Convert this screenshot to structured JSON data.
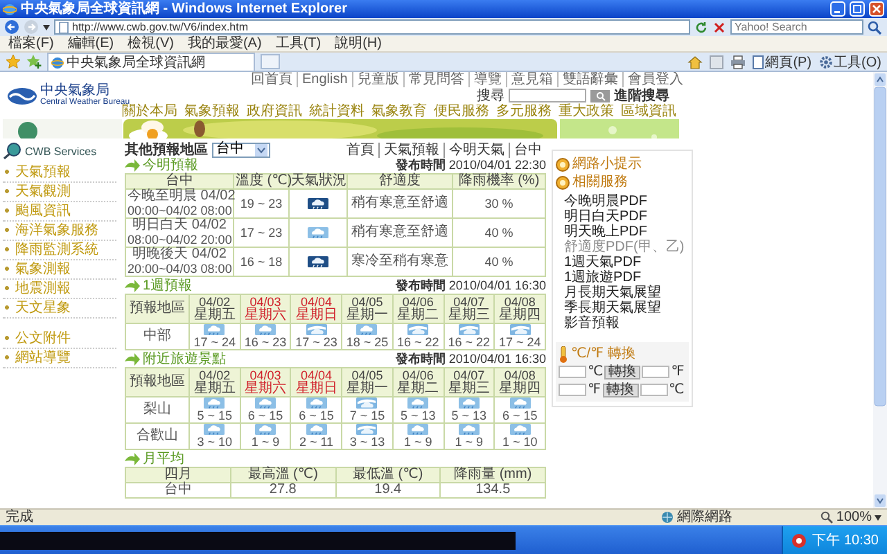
{
  "window": {
    "title": "中央氣象局全球資訊網 - Windows Internet Explorer"
  },
  "address_bar": {
    "url": "http://www.cwb.gov.tw/V6/index.htm"
  },
  "search_box": {
    "placeholder": "Yahoo! Search"
  },
  "menu": [
    "檔案(F)",
    "編輯(E)",
    "檢視(V)",
    "我的最愛(A)",
    "工具(T)",
    "說明(H)"
  ],
  "tab": {
    "title": "中央氣象局全球資訊網"
  },
  "toolbar": [
    {
      "kind": "page",
      "label": "網頁(P)"
    },
    {
      "kind": "tools",
      "label": "工具(O)"
    }
  ],
  "site": {
    "logo_name": "中央氣象局",
    "logo_english": "Central Weather Bureau",
    "top_links": [
      "回首頁",
      "English",
      "兒童版",
      "常見問答",
      "導覽",
      "意見箱",
      "雙語辭彙",
      "會員登入"
    ],
    "search_label": "搜尋",
    "advanced_search": "進階搜尋",
    "nav": [
      "關於本局",
      "氣象預報",
      "政府資訊",
      "統計資料",
      "氣象教育",
      "便民服務",
      "多元服務",
      "重大政策",
      "區域資訊"
    ]
  },
  "sidebar": {
    "title": "CWB Services",
    "items": [
      "天氣預報",
      "天氣觀測",
      "颱風資訊",
      "海洋氣象服務",
      "降雨監測系統",
      "氣象測報",
      "地震測報",
      "天文星象"
    ],
    "extra_items": [
      "公文附件",
      "網站導覽"
    ]
  },
  "breadcrumb": [
    "首頁",
    "天氣預報",
    "今明天氣",
    "台中"
  ],
  "region_select": {
    "label": "其他預報地區",
    "value": "台中"
  },
  "today": {
    "title": "今明預報",
    "issued": "**發布時間** 2010/04/01 22:30",
    "columns": [
      "台中",
      "溫度 (℃)",
      "天氣狀況",
      "舒適度",
      "降雨機率 (%)"
    ],
    "rows": [
      {
        "period": "今晚至明晨 04/02",
        "range": "00:00~04/02 08:00",
        "temperature": "19 ~ 23",
        "kind": "rain",
        "comfort": "稍有寒意至舒適",
        "rain_chance": "30 %"
      },
      {
        "period": "明日白天 04/02",
        "range": "08:00~04/02 20:00",
        "temperature": "17 ~ 23",
        "kind": "showers",
        "comfort": "稍有寒意至舒適",
        "rain_chance": "40 %"
      },
      {
        "period": "明晚後天 04/02",
        "range": "20:00~04/03 08:00",
        "temperature": "16 ~ 18",
        "kind": "rain",
        "comfort": "寒冷至稍有寒意",
        "rain_chance": "40 %"
      }
    ]
  },
  "week": {
    "title": "1週預報",
    "issued": "**發布時間** 2010/04/01 16:30",
    "corner": "預報地區",
    "days": [
      {
        "date": "04/02",
        "weekday": "星期五",
        "holiday": false
      },
      {
        "date": "04/03",
        "weekday": "星期六",
        "holiday": true
      },
      {
        "date": "04/04",
        "weekday": "星期日",
        "holiday": true
      },
      {
        "date": "04/05",
        "weekday": "星期一",
        "holiday": false
      },
      {
        "date": "04/06",
        "weekday": "星期二",
        "holiday": false
      },
      {
        "date": "04/07",
        "weekday": "星期三",
        "holiday": false
      },
      {
        "date": "04/08",
        "weekday": "星期四",
        "holiday": false
      }
    ],
    "rows": [
      {
        "region": "中部",
        "cells": [
          {
            "kind": "showers",
            "temperature": "17 ~ 24"
          },
          {
            "kind": "showers",
            "temperature": "16 ~ 23"
          },
          {
            "kind": "clearing",
            "temperature": "17 ~ 23"
          },
          {
            "kind": "showers",
            "temperature": "18 ~ 25"
          },
          {
            "kind": "clearing",
            "temperature": "16 ~ 22"
          },
          {
            "kind": "clearing",
            "temperature": "16 ~ 22"
          },
          {
            "kind": "clearing",
            "temperature": "17 ~ 24"
          }
        ]
      }
    ]
  },
  "travel": {
    "title": "附近旅遊景點",
    "issued": "**發布時間** 2010/04/01 16:30",
    "corner": "預報地區",
    "days": [
      {
        "date": "04/02",
        "weekday": "星期五",
        "holiday": false
      },
      {
        "date": "04/03",
        "weekday": "星期六",
        "holiday": true
      },
      {
        "date": "04/04",
        "weekday": "星期日",
        "holiday": true
      },
      {
        "date": "04/05",
        "weekday": "星期一",
        "holiday": false
      },
      {
        "date": "04/06",
        "weekday": "星期二",
        "holiday": false
      },
      {
        "date": "04/07",
        "weekday": "星期三",
        "holiday": false
      },
      {
        "date": "04/08",
        "weekday": "星期四",
        "holiday": false
      }
    ],
    "rows": [
      {
        "region": "梨山",
        "cells": [
          {
            "kind": "showers",
            "temperature": "5 ~ 15"
          },
          {
            "kind": "showers",
            "temperature": "6 ~ 15"
          },
          {
            "kind": "showers",
            "temperature": "6 ~ 15"
          },
          {
            "kind": "clearing",
            "temperature": "7 ~ 15"
          },
          {
            "kind": "showers",
            "temperature": "5 ~ 13"
          },
          {
            "kind": "showers",
            "temperature": "5 ~ 13"
          },
          {
            "kind": "showers",
            "temperature": "6 ~ 15"
          }
        ]
      },
      {
        "region": "合歡山",
        "cells": [
          {
            "kind": "showers",
            "temperature": "3 ~ 10"
          },
          {
            "kind": "showers",
            "temperature": "1 ~ 9"
          },
          {
            "kind": "showers",
            "temperature": "2 ~ 11"
          },
          {
            "kind": "clearing",
            "temperature": "3 ~ 13"
          },
          {
            "kind": "showers",
            "temperature": "1 ~ 9"
          },
          {
            "kind": "showers",
            "temperature": "1 ~ 9"
          },
          {
            "kind": "showers",
            "temperature": "1 ~ 10"
          }
        ]
      }
    ]
  },
  "monthly": {
    "title": "月平均",
    "columns": [
      "四月",
      "最高溫 (℃)",
      "最低溫 (℃)",
      "降雨量 (mm)"
    ],
    "rows": [
      [
        "台中",
        "27.8",
        "19.4",
        "134.5"
      ]
    ]
  },
  "tips": {
    "title": "網路小提示"
  },
  "services": {
    "title": "相關服務",
    "items": [
      {
        "label": "今晚明晨PDF",
        "visited": false
      },
      {
        "label": "明日白天PDF",
        "visited": false
      },
      {
        "label": "明天晚上PDF",
        "visited": false
      },
      {
        "label": "舒適度PDF(甲、乙)",
        "visited": true
      },
      {
        "label": "1週天氣PDF",
        "visited": false
      },
      {
        "label": "1週旅遊PDF",
        "visited": false
      },
      {
        "label": "月長期天氣展望",
        "visited": false
      },
      {
        "label": "季長期天氣展望",
        "visited": false
      },
      {
        "label": "影音預報",
        "visited": false
      }
    ]
  },
  "converter": {
    "title": "℃/℉ 轉換",
    "rows": [
      {
        "from": "℃",
        "button": "轉換",
        "to": "℉"
      },
      {
        "from": "℉",
        "button": "轉換",
        "to": "℃"
      }
    ]
  },
  "status_bar": {
    "text": "完成",
    "zone": "網際網路",
    "zoom": "100%"
  },
  "taskbar": {
    "clock": "下午 10:30"
  }
}
